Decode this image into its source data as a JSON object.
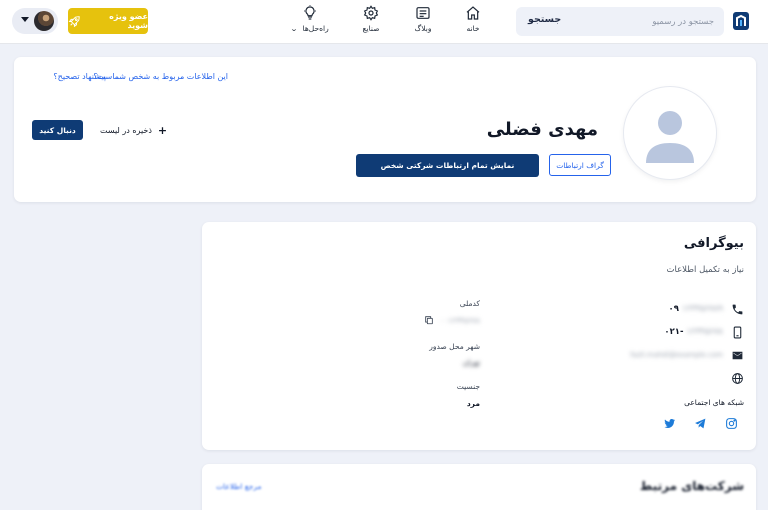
{
  "header": {
    "search_placeholder": "جستجو در رسمیو",
    "search_button": "جستجو",
    "nav": [
      {
        "label": "خانه",
        "icon": "home-icon"
      },
      {
        "label": "وبلاگ",
        "icon": "newspaper-icon"
      },
      {
        "label": "صنایع",
        "icon": "gear-icon"
      },
      {
        "label": "راه‌حل‌ها",
        "icon": "lightbulb-icon"
      }
    ],
    "premium_label": "عضو ویژه شوید"
  },
  "profile": {
    "name": "مهدی فضلی",
    "report_question": "این اطلاعات مربوط به شخص شماست؟",
    "report_link": "پیشنهاد تصحیح؟",
    "follow_label": "دنبال کنید",
    "save_label": "ذخیره در لیست",
    "show_all_label": "نمایش تمام ارتباطات شرکتی شخص",
    "graph_label": "گراف ارتباطات"
  },
  "bio": {
    "title": "بیوگرافی",
    "subtitle": "نیاز به تکمیل اطلاعات",
    "phone_prefix": "۰۹",
    "phone_rest": "۱۲۳۴۵۶۷۸۹",
    "landline_prefix": "۰۲۱-",
    "landline_rest": "۱۲۳۴۵۶۷۸",
    "email": "fazli.mahdi@example.com",
    "social_title": "شبکه های اجتماعی",
    "national_id_label": "کدملی",
    "national_id_value": "۰۰۱۲۳۴۵۶۷۸",
    "birthplace_label": "شهر محل صدور",
    "birthplace_value": "تهران",
    "gender_label": "جنسیت",
    "gender_value": "مرد"
  },
  "related": {
    "title": "شرکت‌های مرتبط",
    "source_link": "مرجع اطلاعات"
  },
  "colors": {
    "primary": "#0f3b75",
    "accent": "#2563eb",
    "premium": "#e6c20d",
    "background": "#eef1f8"
  }
}
